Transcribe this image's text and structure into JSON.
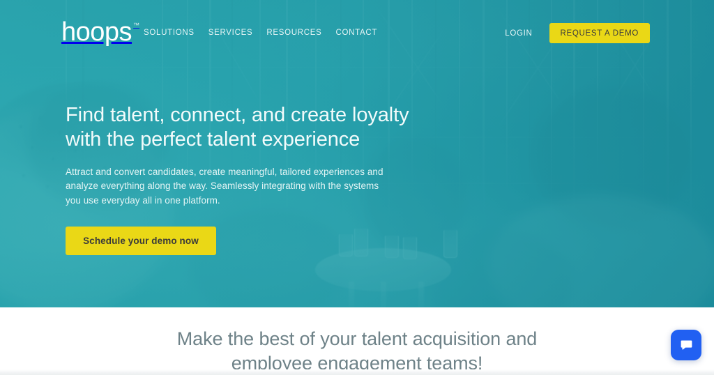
{
  "site": {
    "logo_text": "hoops",
    "logo_trademark": "™"
  },
  "nav": {
    "links": [
      {
        "label": "SOLUTIONS"
      },
      {
        "label": "SERVICES"
      },
      {
        "label": "RESOURCES"
      },
      {
        "label": "CONTACT"
      }
    ],
    "login_label": "LOGIN",
    "demo_button_label": "REQUEST A DEMO"
  },
  "hero": {
    "title_line1": "Find talent, connect, and create loyalty",
    "title_line2": "with the perfect talent experience",
    "subtitle": "Attract and convert candidates, create meaningful, tailored experiences and analyze everything along the way. Seamlessly integrating with the systems you use everyday all in one platform.",
    "cta_label": "Schedule your demo now"
  },
  "section": {
    "heading_line1": "Make the best of your talent acquisition and",
    "heading_line2": "employee engagement teams!"
  },
  "chat": {
    "icon": "chat-bubble-icon",
    "aria_label": "Open chat"
  },
  "colors": {
    "teal": "#2aa6b0",
    "teal_dark": "#1c8c9c",
    "yellow": "#ead816",
    "yellow_text": "#3a3a3a",
    "white": "#ffffff",
    "heading_gray": "#6e8288",
    "chat_blue": "#2160f2"
  }
}
